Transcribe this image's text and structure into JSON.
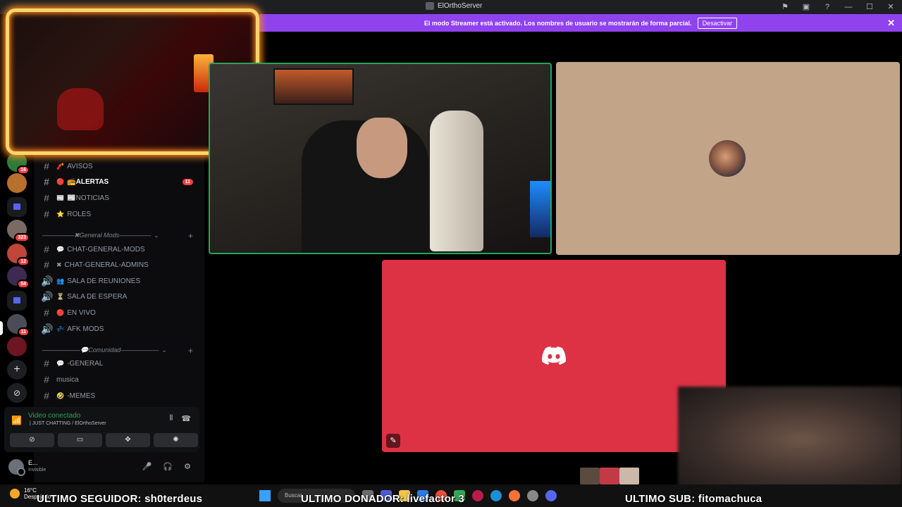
{
  "window": {
    "title": "ElOrthoServer"
  },
  "banner": {
    "text": "El modo Streamer está activado. Los nombres de usuario se mostrarán de forma parcial.",
    "button_label": "Desactivar",
    "close": "✕",
    "color": "#8f42ee"
  },
  "servers": [
    {
      "badge": "16"
    },
    {
      "badge": ""
    },
    {
      "badge": ""
    },
    {
      "badge": "323"
    },
    {
      "badge": "12"
    },
    {
      "badge": "54"
    },
    {
      "badge": ""
    },
    {
      "badge": "11"
    },
    {
      "badge": ""
    }
  ],
  "channels": {
    "avisos": {
      "emoji": "🧨",
      "label": "AVISOS"
    },
    "alertas": {
      "emoji": "🔴",
      "label": "📻ALERTAS",
      "count": "11"
    },
    "noticias": {
      "emoji": "📰",
      "label": "📰NOTICIAS"
    },
    "roles": {
      "emoji": "⭐",
      "label": "ROLES"
    },
    "cat_mods": "—————✖General Mods—————",
    "chat_mods": {
      "emoji": "💬",
      "label": "CHAT-GENERAL-MODS"
    },
    "chat_admins": {
      "emoji": "✖",
      "label": "CHAT-GENERAL-ADMINS"
    },
    "reuniones": {
      "emoji": "👥",
      "label": "SALA DE REUNIONES"
    },
    "espera": {
      "emoji": "⏳",
      "label": "SALA DE ESPERA"
    },
    "envivo": {
      "emoji": "🔴",
      "label": "EN VIVO"
    },
    "afk": {
      "emoji": "💤",
      "label": "AFK MODS"
    },
    "cat_comunidad": "——————💬Comunidad——————",
    "general": {
      "emoji": "💬",
      "label": "-GENERAL"
    },
    "musica": {
      "label": "musica"
    },
    "memes": {
      "emoji": "🤣",
      "label": "-MEMES"
    }
  },
  "voice": {
    "status": "Video conectado",
    "location": "| JUST CHATTING / ElOrthoServer"
  },
  "user": {
    "name": "E...",
    "status": "Invisible"
  },
  "taskbar": {
    "temperature": "16°C",
    "weather_label": "Despejado",
    "search_placeholder": "Buscar"
  },
  "stream_overlay": {
    "seguidor": "ULTIMO SEGUIDOR: sh0terdeus",
    "donador": "ULTIMO DONADOR: livefactor 3",
    "sub": "ULTIMO SUB: fitomachuca"
  },
  "colors": {
    "speaking_border": "#23a55a",
    "tile_beige": "#c2a488",
    "tile_red": "#dd3244",
    "badge_red": "#f23f42"
  }
}
